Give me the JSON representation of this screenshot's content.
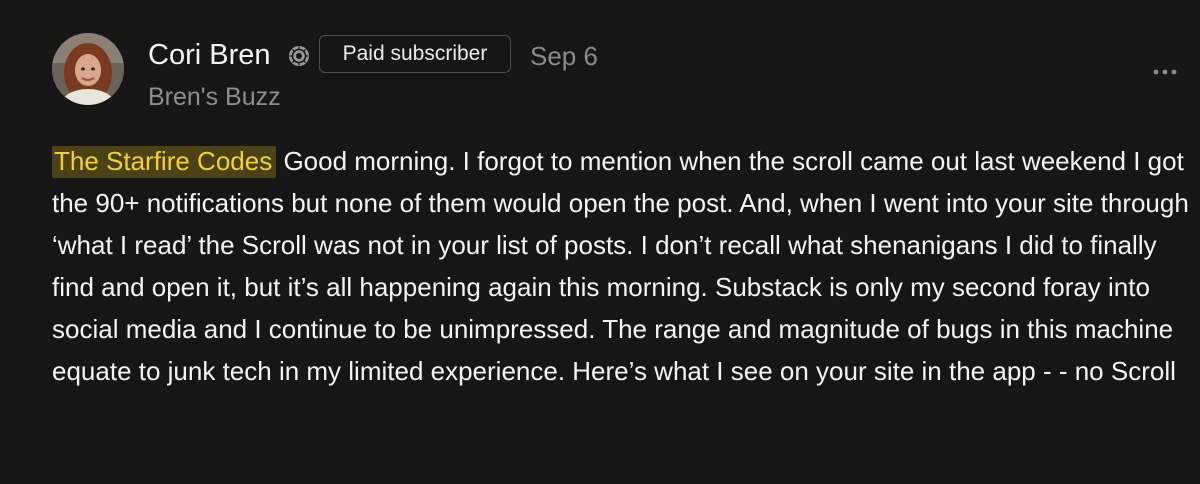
{
  "comment": {
    "author": {
      "name": "Cori Bren",
      "badge": "Paid subscriber",
      "publication": "Bren's Buzz"
    },
    "date": "Sep 6",
    "mention": "The Starfire Codes",
    "body": " Good morning. I forgot to mention when the scroll came out last weekend I got the 90+ notifications but none of them would open the post. And, when I went into your site through ‘what I read’ the Scroll was not in your list of posts. I don’t recall what shenanigans I did to finally find and open it, but it’s all happening again this morning. Substack is only my second foray into social media and I continue to be unimpressed. The range and magnitude of bugs in this machine equate to junk tech in my limited experience. Here’s what I see on your site in the app - - no Scroll"
  },
  "icons": {
    "verified": "verified-badge-icon",
    "more": "more-horizontal-icon"
  },
  "colors": {
    "background": "#161616",
    "text": "#f4f4f4",
    "muted": "#8a8a8a",
    "mention_text": "#f2d233",
    "mention_bg": "#4b4216"
  }
}
